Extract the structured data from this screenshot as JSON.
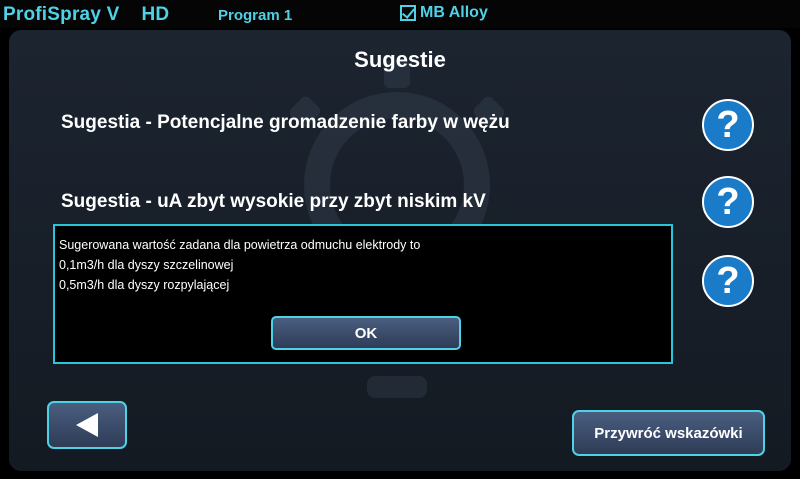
{
  "header": {
    "brand": "ProfiSpray  V",
    "brand_suffix": "HD",
    "program": "Program 1",
    "alloy_checked": true,
    "alloy_label": "MB Alloy"
  },
  "page": {
    "title": "Sugestie"
  },
  "suggestions": [
    {
      "label": "Sugestia - Potencjalne gromadzenie farby w wężu",
      "icon": "question-icon"
    },
    {
      "label": "Sugestia - uA zbyt wysokie przy zbyt niskim kV",
      "icon": "question-icon"
    },
    {
      "label": "",
      "icon": "question-icon"
    }
  ],
  "dialog": {
    "lines": [
      "Sugerowana wartość zadana dla powietrza odmuchu elektrody to",
      "0,1m3/h dla dyszy szczelinowej",
      "0,5m3/h dla dyszy rozpylającej"
    ],
    "ok_label": "OK"
  },
  "footer": {
    "back_icon": "back-arrow-icon",
    "restore_label": "Przywróć wskazówki"
  },
  "colors": {
    "accent": "#4fd1e6",
    "help_blue": "#1a7bc8",
    "panel": "#1c2430",
    "dialog_border": "#28c6da"
  }
}
